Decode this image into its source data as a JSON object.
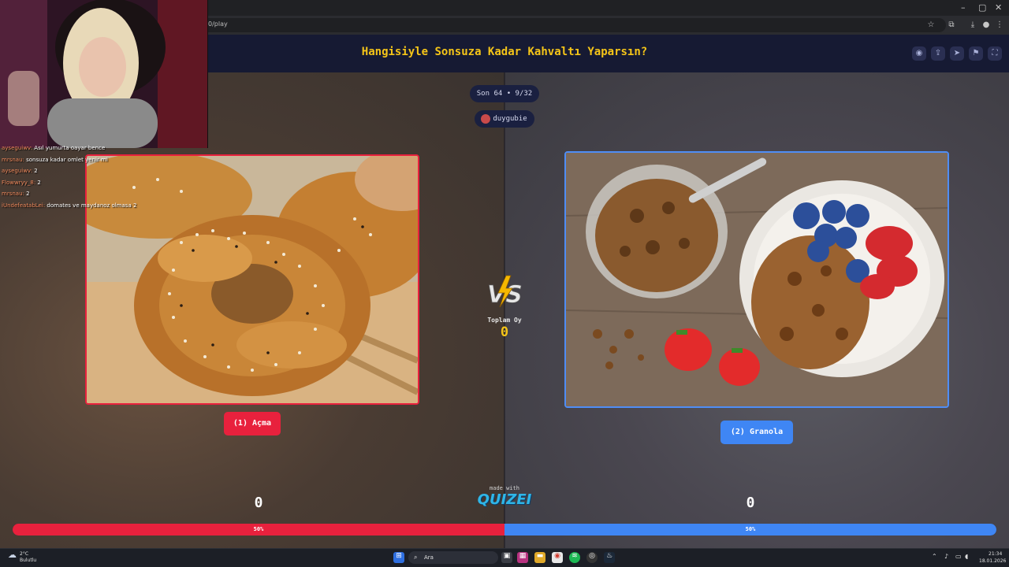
{
  "browser": {
    "url": "0/play",
    "window_controls": [
      "–",
      "▢",
      "✕"
    ]
  },
  "header": {
    "title": "Hangisiyle Sonsuza Kadar Kahvaltı Yaparsın?"
  },
  "round": {
    "stage": "Son 64 • 9/32",
    "creator": "duygubie"
  },
  "options": [
    {
      "label": "(1) Açma",
      "score": "0",
      "percent": "50%"
    },
    {
      "label": "(2) Granola",
      "score": "0",
      "percent": "50%"
    }
  ],
  "vote_split": {
    "left_fraction": 0.5,
    "right_fraction": 0.5
  },
  "center": {
    "vs_text": "VS",
    "total_label": "Toplam Oy",
    "total_value": "0",
    "made_with": "made with",
    "logo": "QUIZEI"
  },
  "chat": [
    {
      "user": "ayseguiwv:",
      "msg": "Asıl yumurta oayar bence"
    },
    {
      "user": "mrsnau:",
      "msg": "sonsuza kadar omlet yenir mi"
    },
    {
      "user": "ayseguiwv:",
      "msg": "2"
    },
    {
      "user": "Flowwryy_8:",
      "msg": "2"
    },
    {
      "user": "mrsnau:",
      "msg": "2"
    },
    {
      "user": "iUndefeatabLei:",
      "msg": "domates ve maydanoz olmasa 2"
    }
  ],
  "taskbar": {
    "weather_temp": "2°C",
    "weather_desc": "Bulutlu",
    "search_placeholder": "Ara",
    "time": "21:34",
    "date": "18.01.2026"
  },
  "colors": {
    "option_left": "#e8213d",
    "option_right": "#3f86f4",
    "title": "#f5c518",
    "header_bg": "#161a33"
  }
}
